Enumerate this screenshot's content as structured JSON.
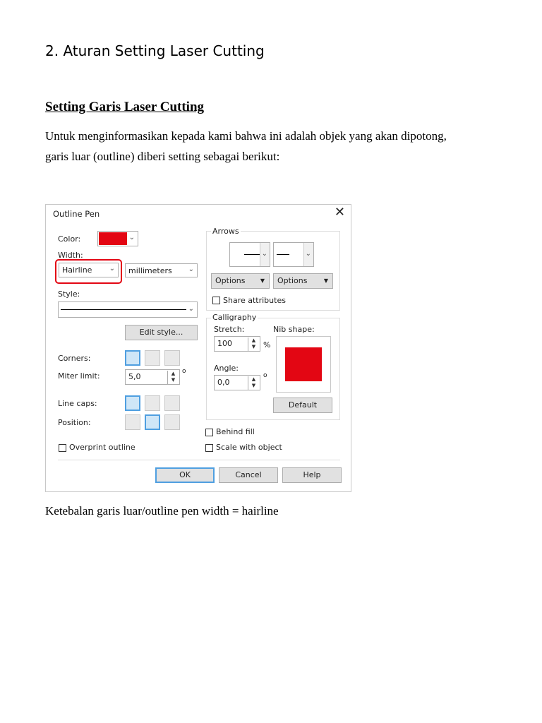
{
  "heading": "2. Aturan Setting Laser Cutting",
  "subheading": "Setting Garis Laser Cutting",
  "paragraph": "Untuk menginformasikan kepada kami bahwa ini adalah objek yang akan dipotong, garis luar (outline) diberi setting sebagai berikut:",
  "caption": "Ketebalan garis luar/outline pen width = hairline",
  "dialog": {
    "title": "Outline Pen",
    "color_label": "Color:",
    "color_value": "#e30613",
    "width_label": "Width:",
    "width_value": "Hairline",
    "units_value": "millimeters",
    "style_label": "Style:",
    "edit_style": "Edit style...",
    "corners_label": "Corners:",
    "miter_label": "Miter limit:",
    "miter_value": "5,0",
    "miter_unit": "o",
    "linecaps_label": "Line caps:",
    "position_label": "Position:",
    "overprint_label": "Overprint outline",
    "arrows_label": "Arrows",
    "options_label": "Options",
    "share_label": "Share attributes",
    "calligraphy_label": "Calligraphy",
    "stretch_label": "Stretch:",
    "stretch_value": "100",
    "stretch_unit": "%",
    "nib_label": "Nib shape:",
    "angle_label": "Angle:",
    "angle_value": "0,0",
    "angle_unit": "o",
    "default_label": "Default",
    "behind_fill_label": "Behind fill",
    "scale_label": "Scale with object",
    "ok_label": "OK",
    "cancel_label": "Cancel",
    "help_label": "Help",
    "highlight_color": "#e30613",
    "selected_color": "#4f9fe0"
  }
}
